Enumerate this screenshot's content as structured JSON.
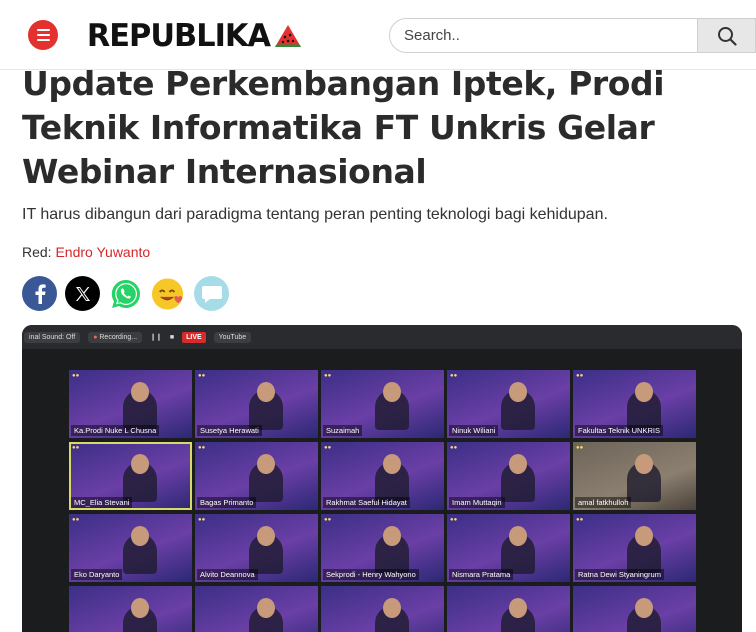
{
  "header": {
    "logo": "REPUBLIKA",
    "search_placeholder": "Search.."
  },
  "article": {
    "title": "Update Perkembangan Iptek, Prodi Teknik Informatika FT Unkris Gelar Webinar Internasional",
    "subtitle": "IT harus dibangun dari paradigma tentang peran penting teknologi bagi kehidupan.",
    "redaksi_label": "Red:",
    "redaksi_name": "Endro Yuwanto"
  },
  "share": {
    "icons": [
      "facebook-icon",
      "x-icon",
      "whatsapp-icon",
      "emoji-icon",
      "comment-icon"
    ]
  },
  "zoom": {
    "audio": "inal Sound: Off",
    "recording": "Recording...",
    "live": "LIVE",
    "youtube": "YouTube"
  },
  "participants": [
    "Ka.Prodi Nuke L Chusna",
    "Susetya Herawati",
    "Suzaimah",
    "Ninuk Wiliani",
    "Fakultas Teknik UNKRIS",
    "MC_Elia Stevani",
    "Bagas Primanto",
    "Rakhmat Saeful Hidayat",
    "Imam Muttaqin",
    "amal fatkhulloh",
    "Eko Daryanto",
    "Alvito Deannova",
    "Sekprodi - Henry Wahyono",
    "Nismara Pratama",
    "Ratna Dewi Styaningrum"
  ],
  "colors": {
    "brand_red": "#e3312f",
    "link_red": "#d7262b",
    "facebook": "#3a5896",
    "whatsapp": "#25d366"
  }
}
